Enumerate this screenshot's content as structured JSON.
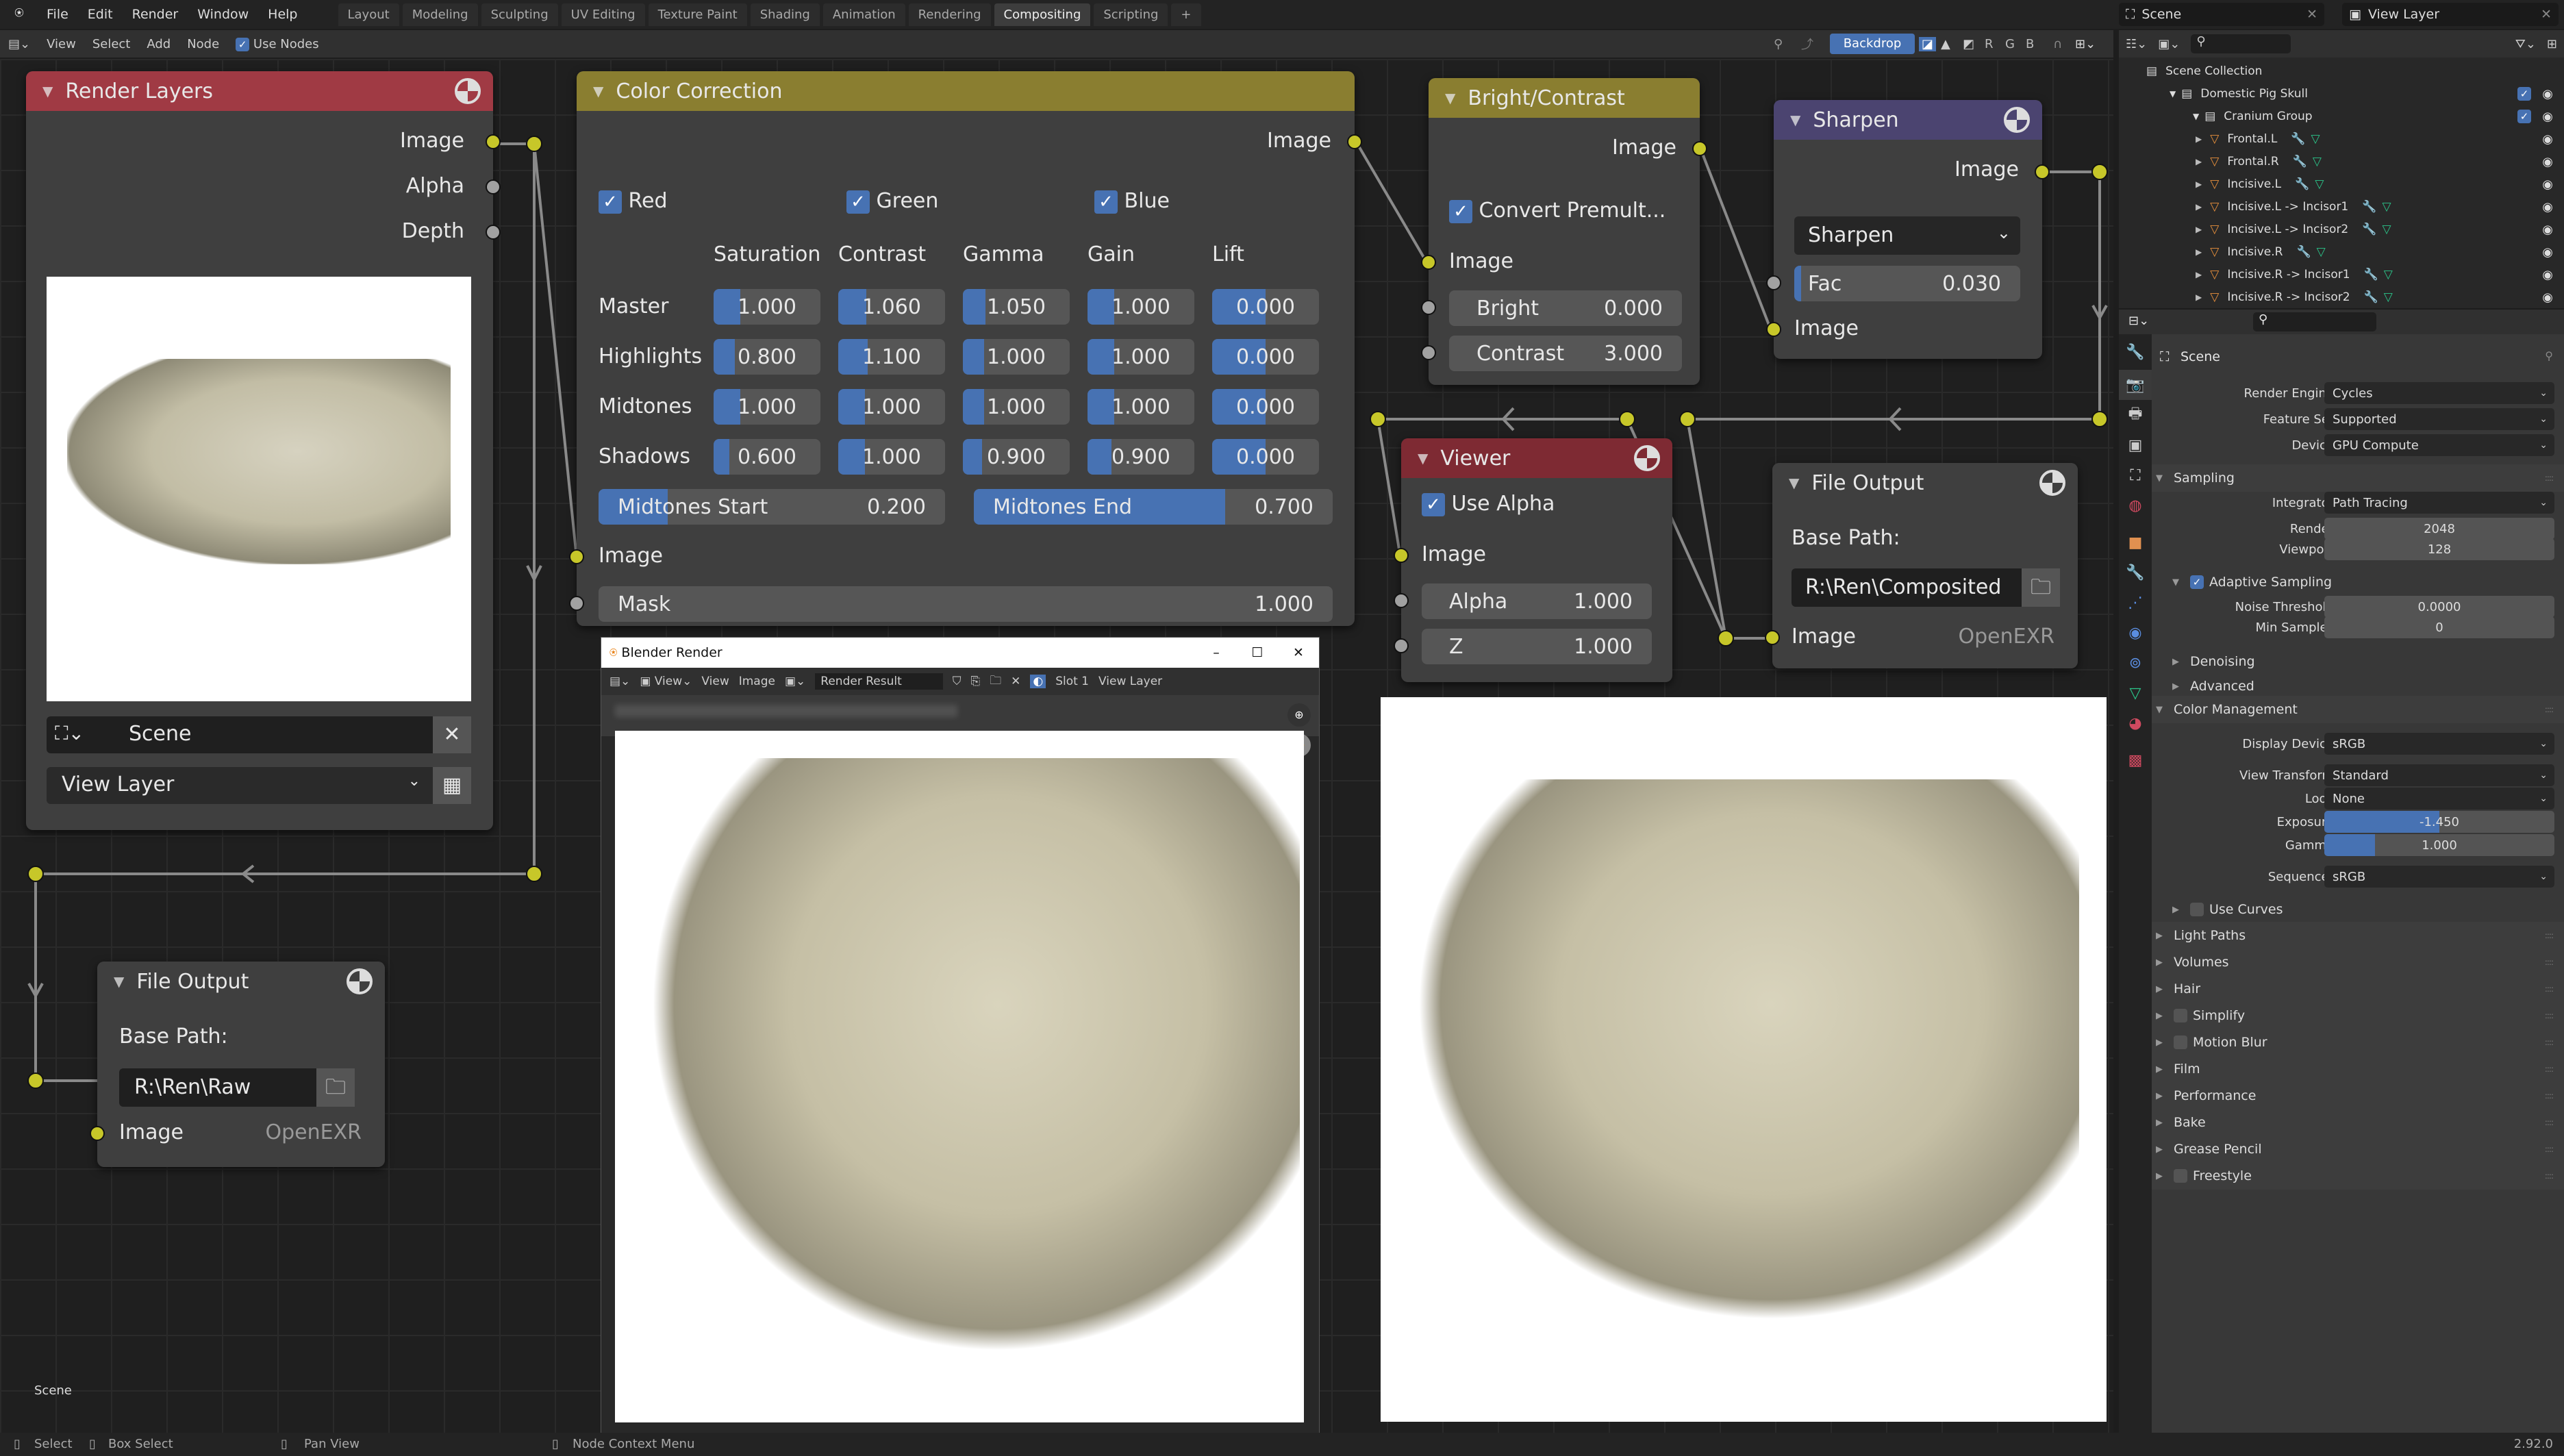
{
  "topbar": {
    "menus": [
      "File",
      "Edit",
      "Render",
      "Window",
      "Help"
    ],
    "workspaces": [
      "Layout",
      "Modeling",
      "Sculpting",
      "UV Editing",
      "Texture Paint",
      "Shading",
      "Animation",
      "Rendering",
      "Compositing",
      "Scripting"
    ],
    "active_workspace": "Compositing",
    "add_tab": "+",
    "scene": "Scene",
    "view_layer": "View Layer"
  },
  "node_header": {
    "menus": [
      "View",
      "Select",
      "Add",
      "Node"
    ],
    "use_nodes_label": "Use Nodes",
    "use_nodes_checked": true,
    "backdrop_label": "Backdrop",
    "channels": [
      "R",
      "G",
      "B"
    ]
  },
  "nodes": {
    "render_layers": {
      "title": "Render Layers",
      "outputs": [
        "Image",
        "Alpha",
        "Depth"
      ],
      "scene": "Scene",
      "view_layer": "View Layer"
    },
    "file_output_raw": {
      "title": "File Output",
      "base_path_label": "Base Path:",
      "base_path": "R:\\Ren\\Raw",
      "input": "Image",
      "format": "OpenEXR"
    },
    "color_correction": {
      "title": "Color Correction",
      "output": "Image",
      "channels": [
        {
          "label": "Red",
          "checked": true
        },
        {
          "label": "Green",
          "checked": true
        },
        {
          "label": "Blue",
          "checked": true
        }
      ],
      "columns": [
        "Saturation",
        "Contrast",
        "Gamma",
        "Gain",
        "Lift"
      ],
      "rows": [
        {
          "label": "Master",
          "values": [
            "1.000",
            "1.060",
            "1.050",
            "1.000",
            "0.000"
          ]
        },
        {
          "label": "Highlights",
          "values": [
            "0.800",
            "1.100",
            "1.000",
            "1.000",
            "0.000"
          ]
        },
        {
          "label": "Midtones",
          "values": [
            "1.000",
            "1.000",
            "1.000",
            "1.000",
            "0.000"
          ]
        },
        {
          "label": "Shadows",
          "values": [
            "0.600",
            "1.000",
            "0.900",
            "0.900",
            "0.000"
          ]
        }
      ],
      "midtones_start": {
        "label": "Midtones Start",
        "value": "0.200",
        "fraction": 0.2
      },
      "midtones_end": {
        "label": "Midtones End",
        "value": "0.700",
        "fraction": 0.7
      },
      "input": "Image",
      "mask": {
        "label": "Mask",
        "value": "1.000"
      }
    },
    "bright_contrast": {
      "title": "Bright/Contrast",
      "output": "Image",
      "convert_label": "Convert Premult...",
      "convert_checked": true,
      "input": "Image",
      "bright": {
        "label": "Bright",
        "value": "0.000"
      },
      "contrast": {
        "label": "Contrast",
        "value": "3.000"
      }
    },
    "sharpen": {
      "title": "Sharpen",
      "output": "Image",
      "mode": "Sharpen",
      "fac": {
        "label": "Fac",
        "value": "0.030",
        "fraction": 0.03
      },
      "input": "Image"
    },
    "viewer": {
      "title": "Viewer",
      "use_alpha_label": "Use Alpha",
      "use_alpha_checked": true,
      "input": "Image",
      "alpha": {
        "label": "Alpha",
        "value": "1.000"
      },
      "z": {
        "label": "Z",
        "value": "1.000"
      }
    },
    "file_output_comp": {
      "title": "File Output",
      "base_path_label": "Base Path:",
      "base_path": "R:\\Ren\\Composited",
      "input": "Image",
      "format": "OpenEXR"
    }
  },
  "render_window": {
    "title": "Blender Render",
    "menus": [
      "View",
      "View",
      "Image"
    ],
    "image_name": "Render Result",
    "slot": "Slot 1",
    "layer": "View Layer"
  },
  "editor_label": "Scene",
  "outliner": {
    "root": "Scene Collection",
    "collections": [
      {
        "name": "Domestic Pig Skull",
        "level": 1
      },
      {
        "name": "Cranium Group",
        "level": 2
      }
    ],
    "objects": [
      "Frontal.L",
      "Frontal.R",
      "Incisive.L",
      "Incisive.L -> Incisor1",
      "Incisive.L -> Incisor2",
      "Incisive.R",
      "Incisive.R -> Incisor1",
      "Incisive.R -> Incisor2"
    ]
  },
  "properties": {
    "context": "Scene",
    "render_engine": {
      "label": "Render Engine",
      "value": "Cycles"
    },
    "feature_set": {
      "label": "Feature Set",
      "value": "Supported"
    },
    "device": {
      "label": "Device",
      "value": "GPU Compute"
    },
    "sampling": {
      "title": "Sampling",
      "integrator": {
        "label": "Integrator",
        "value": "Path Tracing"
      },
      "render": {
        "label": "Render",
        "value": "2048"
      },
      "viewport": {
        "label": "Viewport",
        "value": "128"
      },
      "adaptive": {
        "label": "Adaptive Sampling",
        "checked": true
      },
      "noise_threshold": {
        "label": "Noise Threshold",
        "value": "0.0000"
      },
      "min_samples": {
        "label": "Min Samples",
        "value": "0"
      },
      "subpanels": [
        "Denoising",
        "Advanced"
      ]
    },
    "color_management": {
      "title": "Color Management",
      "display_device": {
        "label": "Display Device",
        "value": "sRGB"
      },
      "view_transform": {
        "label": "View Transform",
        "value": "Standard"
      },
      "look": {
        "label": "Look",
        "value": "None"
      },
      "exposure": {
        "label": "Exposure",
        "value": "-1.450",
        "fraction": 0.5
      },
      "gamma": {
        "label": "Gamma",
        "value": "1.000",
        "fraction": 0.22
      },
      "sequencer": {
        "label": "Sequencer",
        "value": "sRGB"
      },
      "use_curves": {
        "label": "Use Curves",
        "checked": false
      }
    },
    "panels": [
      {
        "label": "Light Paths",
        "checkbox": null
      },
      {
        "label": "Volumes",
        "checkbox": null
      },
      {
        "label": "Hair",
        "checkbox": null
      },
      {
        "label": "Simplify",
        "checkbox": false
      },
      {
        "label": "Motion Blur",
        "checkbox": false
      },
      {
        "label": "Film",
        "checkbox": null
      },
      {
        "label": "Performance",
        "checkbox": null
      },
      {
        "label": "Bake",
        "checkbox": null
      },
      {
        "label": "Grease Pencil",
        "checkbox": null
      },
      {
        "label": "Freestyle",
        "checkbox": false
      }
    ]
  },
  "statusbar": {
    "hints": [
      "Select",
      "Box Select",
      "Pan View",
      "Node Context Menu"
    ],
    "version": "2.92.0"
  },
  "colors": {
    "accent": "#4772b3",
    "socket_image": "#c7c729",
    "socket_value": "#a1a1a1",
    "header_input": "#a03a44",
    "header_color": "#8a7e30",
    "header_filter": "#4b4470",
    "header_output": "#7e2a33"
  }
}
